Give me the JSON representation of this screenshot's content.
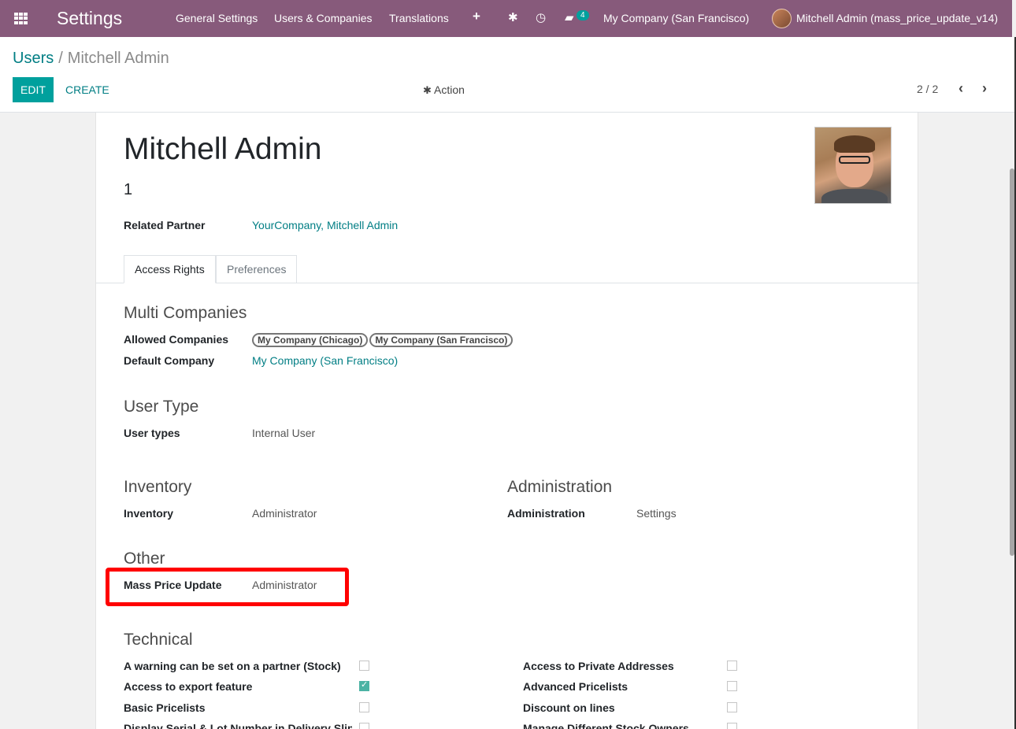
{
  "navbar": {
    "brand": "Settings",
    "menu": [
      "General Settings",
      "Users & Companies",
      "Translations"
    ],
    "message_count": "4",
    "company": "My Company (San Francisco)",
    "user": "Mitchell Admin (mass_price_update_v14)",
    "color": "#875a7b"
  },
  "breadcrumb": {
    "parent": "Users",
    "separator": "/",
    "current": "Mitchell Admin"
  },
  "toolbar": {
    "edit_label": "EDIT",
    "create_label": "CREATE",
    "action_label": "Action"
  },
  "pager": {
    "value": "2 / 2"
  },
  "form": {
    "name": "Mitchell Admin",
    "login": "1",
    "related_partner_label": "Related Partner",
    "related_partner_value": "YourCompany, Mitchell Admin",
    "tabs": [
      {
        "label": "Access Rights",
        "active": true
      },
      {
        "label": "Preferences",
        "active": false
      }
    ],
    "multi_companies": {
      "title": "Multi Companies",
      "allowed_label": "Allowed Companies",
      "allowed_values": [
        "My Company (Chicago)",
        "My Company (San Francisco)"
      ],
      "default_label": "Default Company",
      "default_value": "My Company (San Francisco)"
    },
    "user_type": {
      "title": "User Type",
      "label": "User types",
      "value": "Internal User"
    },
    "inventory": {
      "title": "Inventory",
      "label": "Inventory",
      "value": "Administrator"
    },
    "administration": {
      "title": "Administration",
      "label": "Administration",
      "value": "Settings"
    },
    "other": {
      "title": "Other",
      "label": "Mass Price Update",
      "value": "Administrator"
    },
    "technical": {
      "title": "Technical",
      "left": [
        {
          "label": "A warning can be set on a partner (Stock)",
          "checked": false
        },
        {
          "label": "Access to export feature",
          "checked": true
        },
        {
          "label": "Basic Pricelists",
          "checked": false
        },
        {
          "label": "Display Serial & Lot Number in Delivery Slips",
          "checked": false
        }
      ],
      "right": [
        {
          "label": "Access to Private Addresses",
          "checked": false
        },
        {
          "label": "Advanced Pricelists",
          "checked": false
        },
        {
          "label": "Discount on lines",
          "checked": false
        },
        {
          "label": "Manage Different Stock Owners",
          "checked": false
        }
      ]
    }
  },
  "colors": {
    "accent": "#00a09d",
    "link": "#017e84",
    "highlight": "#ff0000"
  }
}
